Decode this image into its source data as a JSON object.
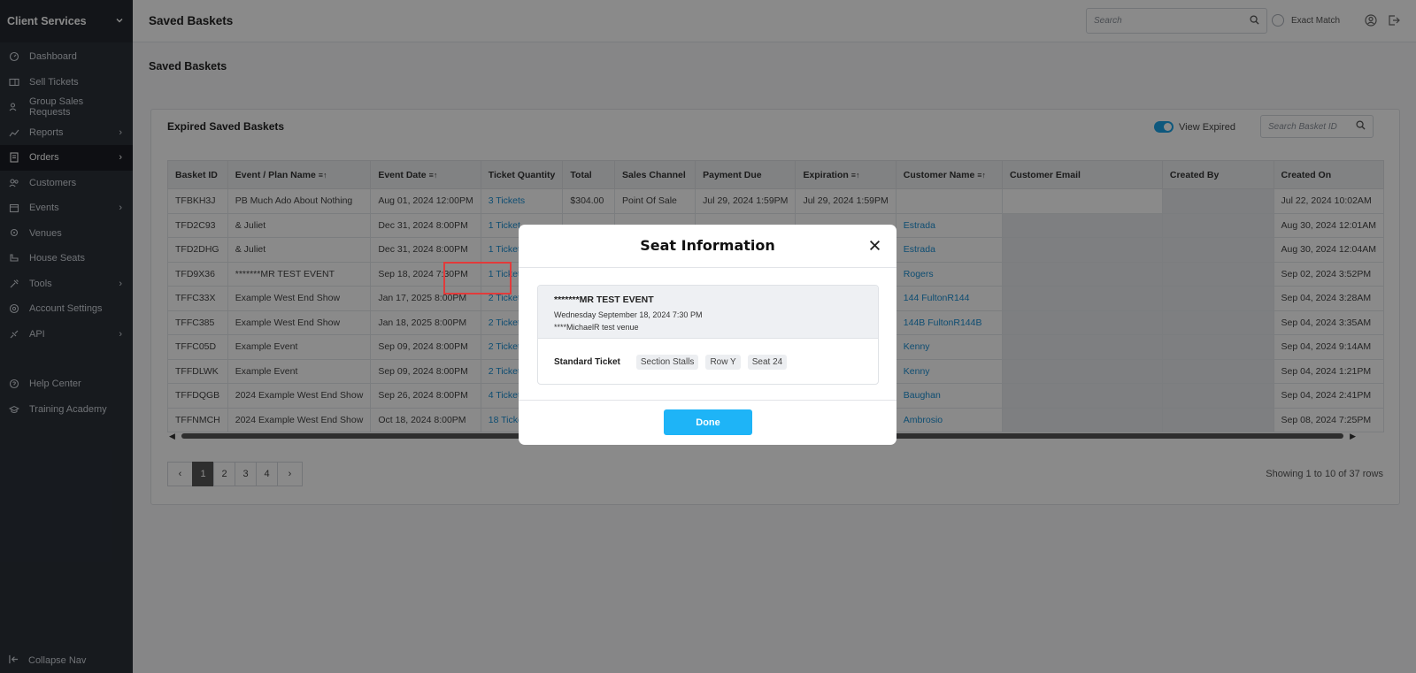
{
  "sidebar": {
    "title": "Client Services",
    "items": [
      {
        "label": "Dashboard",
        "icon": "dashboard-icon",
        "arrow": false,
        "active": false
      },
      {
        "label": "Sell Tickets",
        "icon": "ticket-icon",
        "arrow": false,
        "active": false
      },
      {
        "label": "Group Sales Requests",
        "icon": "group-icon",
        "arrow": false,
        "active": false
      },
      {
        "label": "Reports",
        "icon": "chart-icon",
        "arrow": true,
        "active": false
      },
      {
        "label": "Orders",
        "icon": "orders-icon",
        "arrow": true,
        "active": true
      },
      {
        "label": "Customers",
        "icon": "customers-icon",
        "arrow": false,
        "active": false
      },
      {
        "label": "Events",
        "icon": "calendar-icon",
        "arrow": true,
        "active": false
      },
      {
        "label": "Venues",
        "icon": "venue-icon",
        "arrow": false,
        "active": false
      },
      {
        "label": "House Seats",
        "icon": "seat-icon",
        "arrow": false,
        "active": false
      },
      {
        "label": "Tools",
        "icon": "tools-icon",
        "arrow": true,
        "active": false
      },
      {
        "label": "Account Settings",
        "icon": "settings-icon",
        "arrow": false,
        "active": false
      },
      {
        "label": "API",
        "icon": "api-icon",
        "arrow": true,
        "active": false
      }
    ],
    "help_items": [
      {
        "label": "Help Center",
        "icon": "help-icon"
      },
      {
        "label": "Training Academy",
        "icon": "academy-icon"
      }
    ],
    "collapse_label": "Collapse Nav"
  },
  "topbar": {
    "title": "Saved Baskets",
    "search_placeholder": "Search",
    "exact_match_label": "Exact Match"
  },
  "page": {
    "section_title": "Saved Baskets",
    "card_title": "Expired Saved Baskets",
    "view_expired_label": "View Expired",
    "view_expired_on": true,
    "basket_search_placeholder": "Search Basket ID"
  },
  "table": {
    "columns": [
      "Basket ID",
      "Event / Plan Name",
      "Event Date",
      "Ticket Quantity",
      "Total",
      "Sales Channel",
      "Payment Due",
      "Expiration",
      "Customer Name",
      "Customer Email",
      "Created By",
      "Created On"
    ],
    "rows": [
      [
        "TFBKH3J",
        "PB Much Ado About Nothing",
        "Aug 01, 2024 12:00PM",
        "3 Tickets",
        "$304.00",
        "Point Of Sale",
        "Jul 29, 2024 1:59PM",
        "Jul 29, 2024 1:59PM",
        "",
        "",
        "",
        "Jul 22, 2024 10:02AM"
      ],
      [
        "TFD2C93",
        "& Juliet",
        "Dec 31, 2024 8:00PM",
        "1 Ticket",
        "",
        "",
        "",
        "",
        "Estrada",
        "",
        "",
        "Aug 30, 2024 12:01AM"
      ],
      [
        "TFD2DHG",
        "& Juliet",
        "Dec 31, 2024 8:00PM",
        "1 Ticket",
        "",
        "",
        "",
        "",
        "Estrada",
        "",
        "",
        "Aug 30, 2024 12:04AM"
      ],
      [
        "TFD9X36",
        "*******MR TEST EVENT",
        "Sep 18, 2024 7:30PM",
        "1 Ticket",
        "",
        "",
        "",
        "",
        "Rogers",
        "",
        "",
        "Sep 02, 2024 3:52PM"
      ],
      [
        "TFFC33X",
        "Example West End Show",
        "Jan 17, 2025 8:00PM",
        "2 Tickets",
        "",
        "",
        "",
        "",
        "144 FultonR144",
        "",
        "",
        "Sep 04, 2024 3:28AM"
      ],
      [
        "TFFC385",
        "Example West End Show",
        "Jan 18, 2025 8:00PM",
        "2 Tickets",
        "",
        "",
        "",
        "",
        "144B FultonR144B",
        "",
        "",
        "Sep 04, 2024 3:35AM"
      ],
      [
        "TFFC05D",
        "Example Event",
        "Sep 09, 2024 8:00PM",
        "2 Tickets",
        "",
        "",
        "",
        "",
        "Kenny",
        "",
        "",
        "Sep 04, 2024 9:14AM"
      ],
      [
        "TFFDLWK",
        "Example Event",
        "Sep 09, 2024 8:00PM",
        "2 Tickets",
        "",
        "",
        "",
        "",
        "Kenny",
        "",
        "",
        "Sep 04, 2024 1:21PM"
      ],
      [
        "TFFDQGB",
        "2024 Example West End Show",
        "Sep 26, 2024 8:00PM",
        "4 Tickets",
        "",
        "",
        "",
        "",
        "Baughan",
        "",
        "",
        "Sep 04, 2024 2:41PM"
      ],
      [
        "TFFNMCH",
        "2024 Example West End Show",
        "Oct 18, 2024 8:00PM",
        "18 Tickets",
        "",
        "",
        "",
        "",
        "Ambrosio",
        "",
        "",
        "Sep 08, 2024 7:25PM"
      ]
    ]
  },
  "pagination": {
    "pages": [
      "1",
      "2",
      "3",
      "4"
    ],
    "current": "1",
    "showing": "Showing 1 to 10 of 37 rows"
  },
  "modal": {
    "title": "Seat Information",
    "event_name": "*******MR TEST EVENT",
    "event_date": "Wednesday September 18, 2024 7:30 PM",
    "venue": "****MichaelR test venue",
    "ticket_type": "Standard Ticket",
    "section": "Section Stalls",
    "row": "Row Y",
    "seat": "Seat 24",
    "done_label": "Done"
  },
  "colors": {
    "accent": "#1eb4f7",
    "link": "#1a8fd3",
    "sidebar_bg": "#2b3039",
    "highlight": "#e23b3b"
  }
}
